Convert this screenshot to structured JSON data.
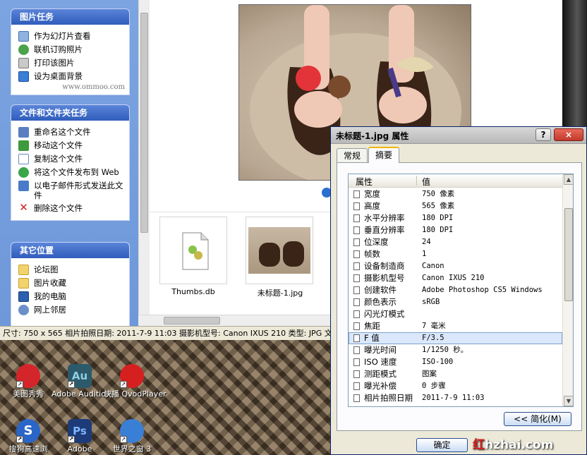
{
  "explorer": {
    "picture_tasks": {
      "title": "图片任务",
      "items": [
        "作为幻灯片查看",
        "联机订购照片",
        "打印该图片",
        "设为桌面背景"
      ],
      "watermark": "www.ommoo.com"
    },
    "file_tasks": {
      "title": "文件和文件夹任务",
      "items": [
        "重命名这个文件",
        "移动这个文件",
        "复制这个文件",
        "将这个文件发布到 Web",
        "以电子邮件形式发送此文件",
        "删除这个文件"
      ]
    },
    "other_places": {
      "title": "其它位置",
      "items": [
        "论坛图",
        "图片收藏",
        "我的电脑",
        "网上邻居"
      ]
    },
    "files": [
      "Thumbs.db",
      "未标题-1.jpg"
    ],
    "status": "尺寸: 750 x 565 相片拍照日期: 2011-7-9 11:03 摄影机型号: Canon IXUS 210 类型: JPG 文件"
  },
  "desktop": {
    "icons": [
      "美图秀秀",
      "Adobe Audition",
      "快播 QvodPlayer",
      "搜狗高速浏",
      "Adobe",
      "世界之窗 3"
    ],
    "colors": [
      "#d4252b",
      "#2d5a6b",
      "#d62020",
      "#2a66c8",
      "#2a55b5",
      "#3a7fd6"
    ]
  },
  "dialog": {
    "title": "未标题-1.jpg 属性",
    "help": "?",
    "close": "×",
    "tabs": [
      "常规",
      "摘要"
    ],
    "col_property": "属性",
    "col_value": "值",
    "rows": [
      {
        "name": "宽度",
        "value": "750 像素"
      },
      {
        "name": "高度",
        "value": "565 像素"
      },
      {
        "name": "水平分辨率",
        "value": "180 DPI"
      },
      {
        "name": "垂直分辨率",
        "value": "180 DPI"
      },
      {
        "name": "位深度",
        "value": "24"
      },
      {
        "name": "帧数",
        "value": "1"
      },
      {
        "name": "设备制造商",
        "value": "Canon"
      },
      {
        "name": "摄影机型号",
        "value": "Canon IXUS 210"
      },
      {
        "name": "创建软件",
        "value": "Adobe Photoshop CS5 Windows"
      },
      {
        "name": "颜色表示",
        "value": "sRGB"
      },
      {
        "name": "闪光灯模式",
        "value": ""
      },
      {
        "name": "焦距",
        "value": "7 毫米"
      },
      {
        "name": "F 值",
        "value": "F/3.5"
      },
      {
        "name": "曝光时间",
        "value": "1/1250 秒。"
      },
      {
        "name": "ISO 速度",
        "value": "ISO-100"
      },
      {
        "name": "测距模式",
        "value": "图案"
      },
      {
        "name": "曝光补偿",
        "value": "0 步骤"
      },
      {
        "name": "相片拍照日期",
        "value": "2011-7-9 11:03"
      }
    ],
    "simplify_button": "<< 简化(M)",
    "ok_button": "确定"
  },
  "brand": {
    "red": "红",
    "white": "hzhai.com"
  }
}
